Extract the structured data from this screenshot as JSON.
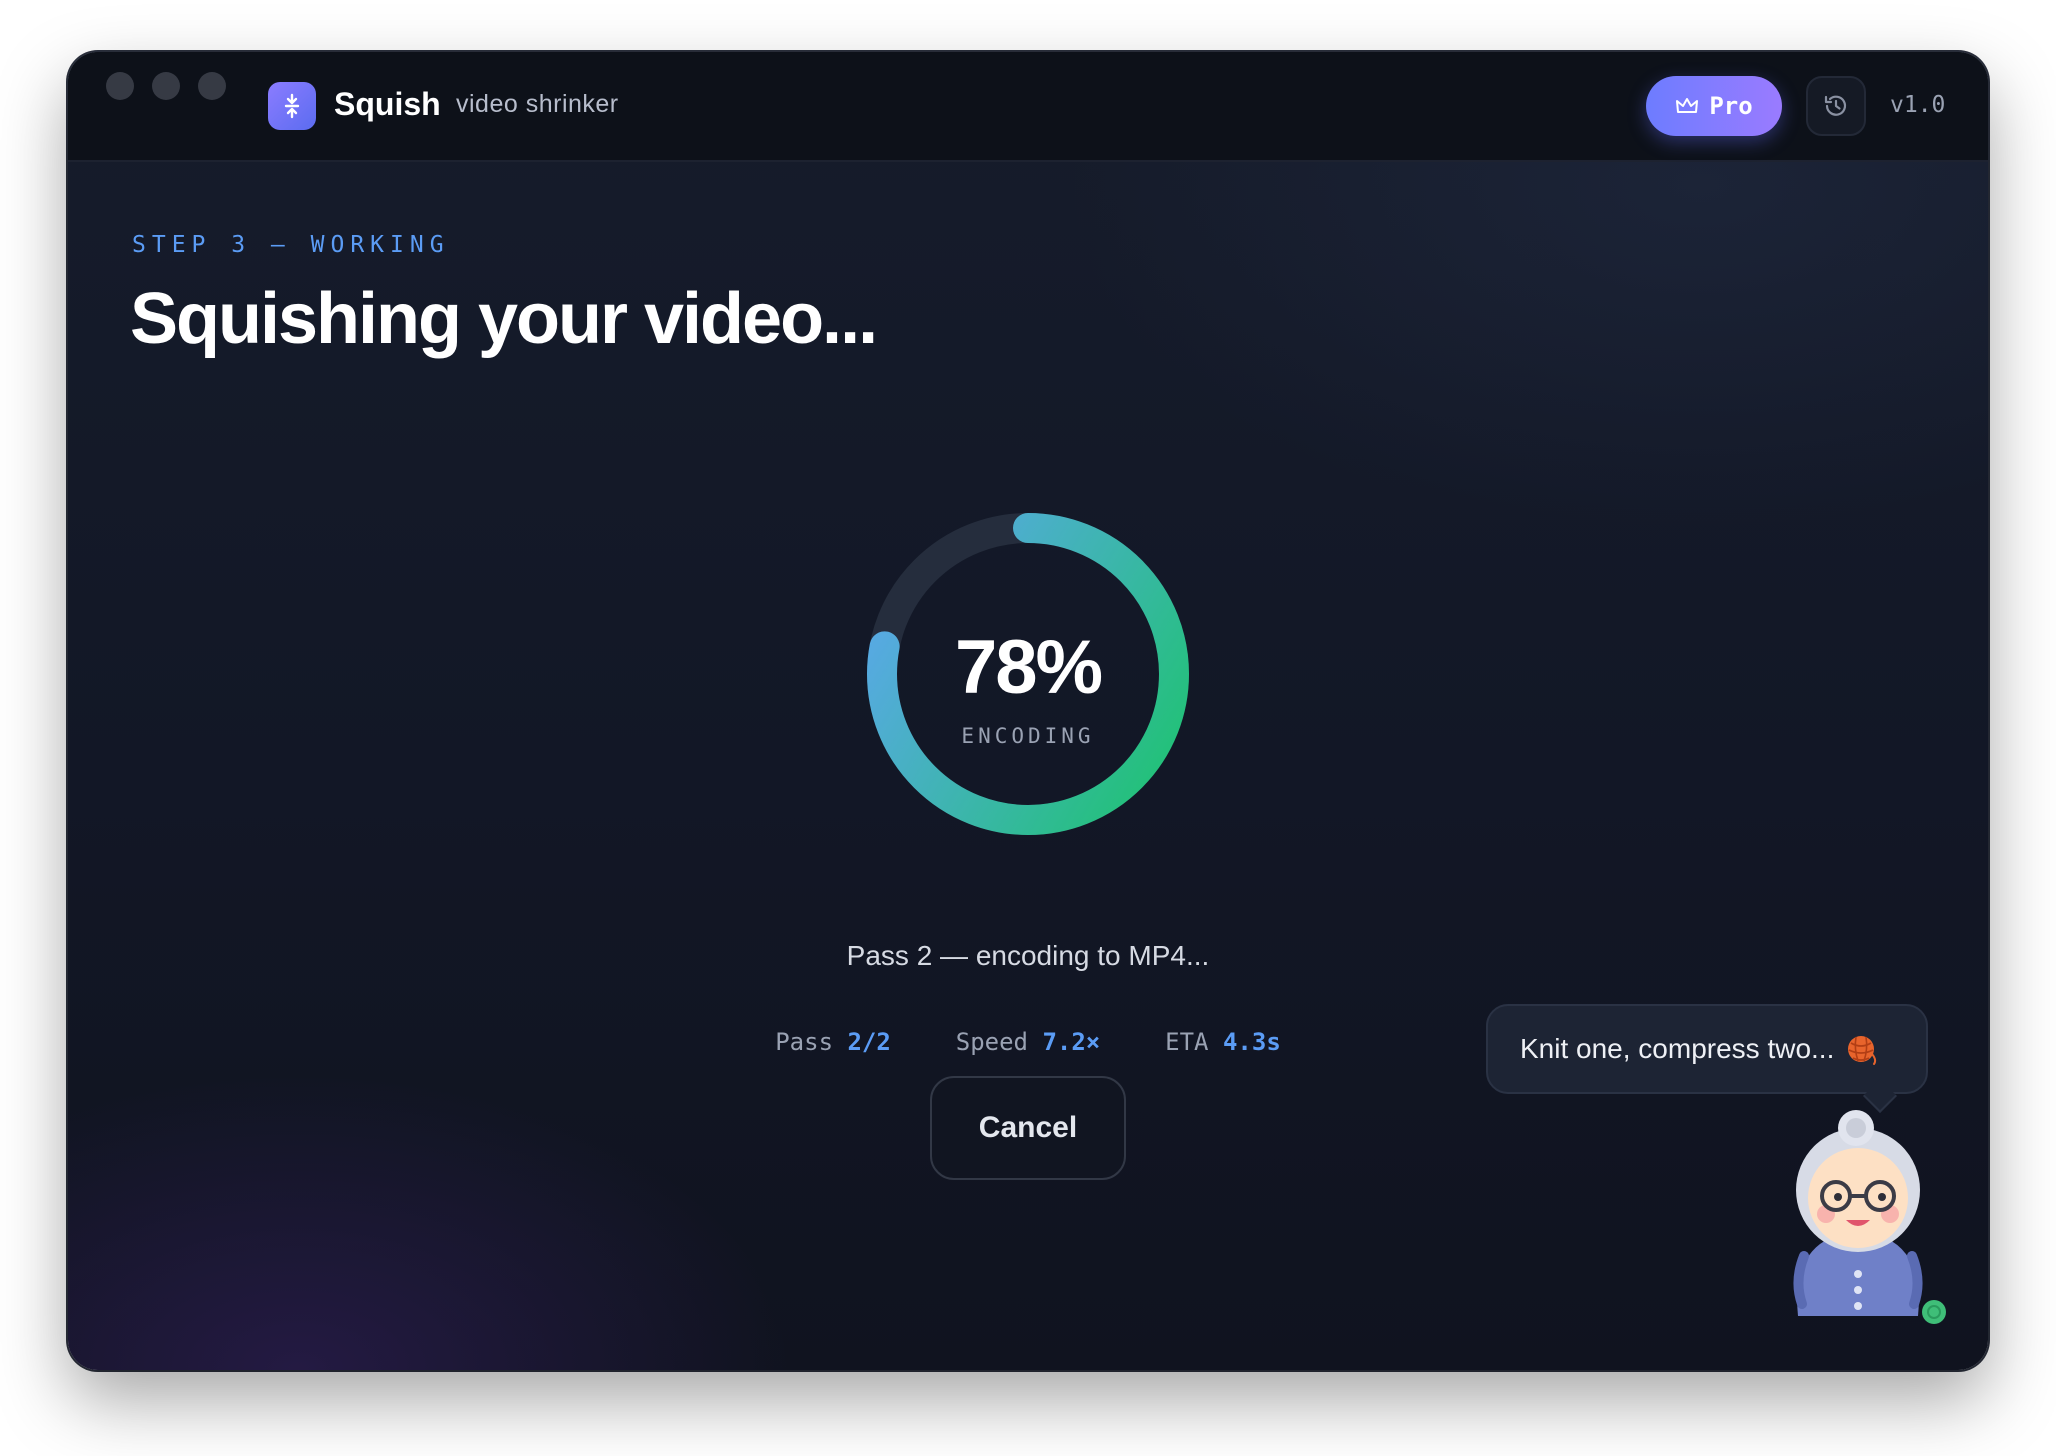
{
  "app": {
    "name": "Squish",
    "subtitle": "video shrinker",
    "version": "v1.0",
    "pro_label": "Pro"
  },
  "step_label": "STEP 3 — WORKING",
  "heading": "Squishing your video...",
  "progress": {
    "percent_text": "78%",
    "fraction": 0.78,
    "status": "ENCODING"
  },
  "pass_text": "Pass 2 — encoding to MP4...",
  "stats": [
    {
      "label": "Pass",
      "value": "2/2"
    },
    {
      "label": "Speed",
      "value": "7.2×"
    },
    {
      "label": "ETA",
      "value": "4.3s"
    }
  ],
  "cancel_label": "Cancel",
  "mascot": {
    "message": "Knit one, compress two..."
  },
  "icons": {
    "app": "squish-arrows-icon",
    "pro": "crown-icon",
    "history": "history-icon",
    "yarn": "yarn-ball-icon",
    "mascot": "grandma-mascot-icon"
  },
  "colors": {
    "accent_blue": "#5b9cf5",
    "pro_gradient_start": "#6d7cff",
    "pro_gradient_end": "#9a7bff",
    "ring_start": "#22c178",
    "ring_end": "#5aa8e8",
    "status_online": "#3fbe78"
  }
}
